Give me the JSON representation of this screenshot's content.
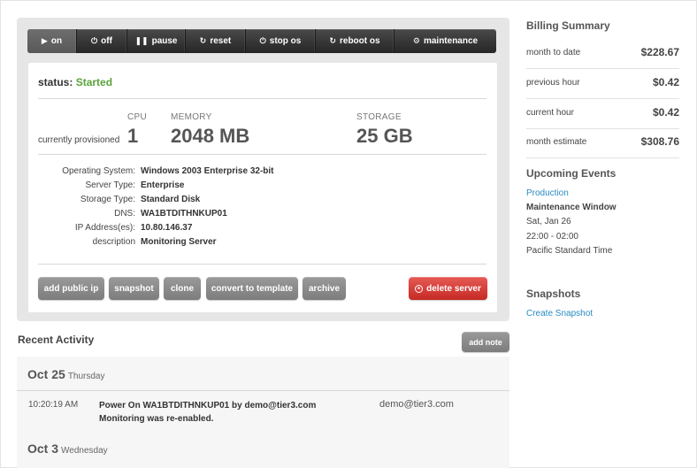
{
  "power_bar": {
    "on": "on",
    "off": "off",
    "pause": "pause",
    "reset": "reset",
    "stop_os": "stop os",
    "reboot_os": "reboot os",
    "maintenance": "maintenance",
    "active": "on"
  },
  "status": {
    "label": "status:",
    "value": "Started",
    "color": "#5aa33b"
  },
  "provisioned": {
    "label": "currently provisioned",
    "cpu": {
      "label": "CPU",
      "value": "1"
    },
    "memory": {
      "label": "MEMORY",
      "value": "2048 MB"
    },
    "storage": {
      "label": "STORAGE",
      "value": "25 GB"
    }
  },
  "details": [
    {
      "key": "Operating System:",
      "value": "Windows 2003 Enterprise 32-bit"
    },
    {
      "key": "Server Type:",
      "value": "Enterprise"
    },
    {
      "key": "Storage Type:",
      "value": "Standard Disk"
    },
    {
      "key": "DNS:",
      "value": "WA1BTDITHNKUP01"
    },
    {
      "key": "IP Address(es):",
      "value": "10.80.146.37"
    },
    {
      "key": "description",
      "value": "Monitoring Server"
    }
  ],
  "actions": {
    "add_public_ip": "add public ip",
    "snapshot": "snapshot",
    "clone": "clone",
    "convert_to_template": "convert to template",
    "archive": "archive",
    "delete_server": "delete server",
    "delete_color": "#d9413c"
  },
  "recent_activity": {
    "title": "Recent Activity",
    "add_note": "add note",
    "groups": [
      {
        "date": "Oct 25",
        "weekday": "Thursday",
        "entries": [
          {
            "time": "10:20:19 AM",
            "line1": "Power On WA1BTDITHNKUP01 by demo@tier3.com",
            "line2": "Monitoring was re-enabled.",
            "user": "demo@tier3.com"
          }
        ]
      },
      {
        "date": "Oct 3",
        "weekday": "Wednesday"
      }
    ]
  },
  "billing": {
    "title": "Billing Summary",
    "rows": [
      {
        "label": "month to date",
        "value": "$228.67"
      },
      {
        "label": "previous hour",
        "value": "$0.42"
      },
      {
        "label": "current hour",
        "value": "$0.42"
      },
      {
        "label": "month estimate",
        "value": "$308.76"
      }
    ]
  },
  "upcoming": {
    "title": "Upcoming Events",
    "link": "Production",
    "name": "Maintenance Window",
    "date": "Sat, Jan 26",
    "time": "22:00 - 02:00",
    "tz": "Pacific Standard Time"
  },
  "snapshots": {
    "title": "Snapshots",
    "create": "Create Snapshot"
  },
  "colors": {
    "link": "#2a8bc4",
    "panel": "#e6e6e6",
    "bar": "#2e2e2e"
  },
  "icons": [
    "play-icon",
    "power-icon",
    "pause-icon",
    "refresh-icon",
    "gear-icon",
    "delete-circle-icon"
  ]
}
